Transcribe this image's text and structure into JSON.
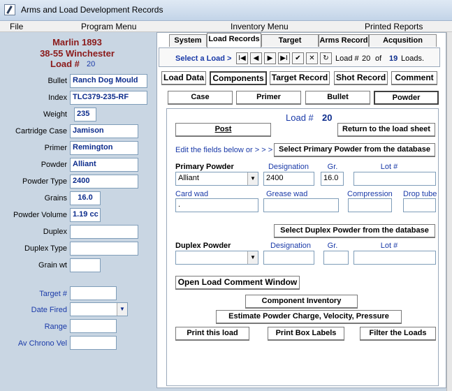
{
  "window": {
    "title": "Arms and Load Development Records"
  },
  "menus": [
    "File",
    "Program Menu",
    "Inventory Menu",
    "Printed Reports"
  ],
  "left": {
    "rifle": "Marlin 1893",
    "caliber": "38-55 Winchester",
    "load_label": "Load #",
    "load_no": "20",
    "fields": [
      {
        "label": "Bullet",
        "value": "Ranch Dog Mould"
      },
      {
        "label": "Index",
        "value": "TLC379-235-RF"
      },
      {
        "label": "Weight",
        "value": "235"
      },
      {
        "label": "Cartridge Case",
        "value": "Jamison"
      },
      {
        "label": "Primer",
        "value": "Remington"
      },
      {
        "label": "Powder",
        "value": "Alliant"
      },
      {
        "label": "Powder Type",
        "value": "2400"
      },
      {
        "label": "Grains",
        "value": "16.0"
      },
      {
        "label": "Powder Volume",
        "value": "1.19 cc"
      },
      {
        "label": "Duplex",
        "value": ""
      },
      {
        "label": "Duplex Type",
        "value": ""
      },
      {
        "label": "Grain wt",
        "value": ""
      },
      {
        "label": "Target #",
        "value": ""
      },
      {
        "label": "Date Fired",
        "value": ""
      },
      {
        "label": "Range",
        "value": ""
      },
      {
        "label": "Av Chrono Vel",
        "value": ""
      }
    ]
  },
  "tabs": [
    "System",
    "Load Records",
    "Target Analysis",
    "Arms Record",
    "Acqusition Record"
  ],
  "nav": {
    "select": "Select a Load >",
    "first": "I◀",
    "prev": "◀",
    "next": "▶",
    "last": "▶I",
    "ok": "✔",
    "cancel": "✕",
    "refresh": "↻",
    "load_label": "Load #",
    "load_no": "20",
    "of": "of",
    "total": "19",
    "loads": "Loads."
  },
  "subtabs": [
    "Load Data",
    "Components",
    "Target Record",
    "Shot Record",
    "Comment"
  ],
  "comptabs": [
    "Case",
    "Primer",
    "Bullet",
    "Powder"
  ],
  "powder": {
    "load_label": "Load #",
    "load_no": "20",
    "post": "Post",
    "return": "Return to the load sheet",
    "edit_text": "Edit the fields below or > > >",
    "select_primary": "Select Primary Powder from the database",
    "primary_label": "Primary Powder",
    "designation_label": "Designation",
    "gr_label": "Gr.",
    "lot_label": "Lot #",
    "primary_value": "Alliant",
    "designation_value": "2400",
    "gr_value": "16.0",
    "lot_value": "",
    "card_wad_label": "Card wad",
    "grease_wad_label": "Grease wad",
    "compression_label": "Compression",
    "drop_tube_label": "Drop tube",
    "card_wad_value": ".",
    "select_duplex": "Select Duplex Powder from the database",
    "duplex_label": "Duplex Powder",
    "duplex_designation_label": "Designation",
    "duplex_gr_label": "Gr.",
    "duplex_lot_label": "Lot #",
    "open_comment": "Open Load Comment Window",
    "component_inventory": "Component Inventory",
    "estimate": "Estimate Powder Charge, Velocity, Pressure",
    "print_load": "Print this load",
    "print_labels": "Print Box Labels",
    "filter": "Filter the Loads"
  }
}
